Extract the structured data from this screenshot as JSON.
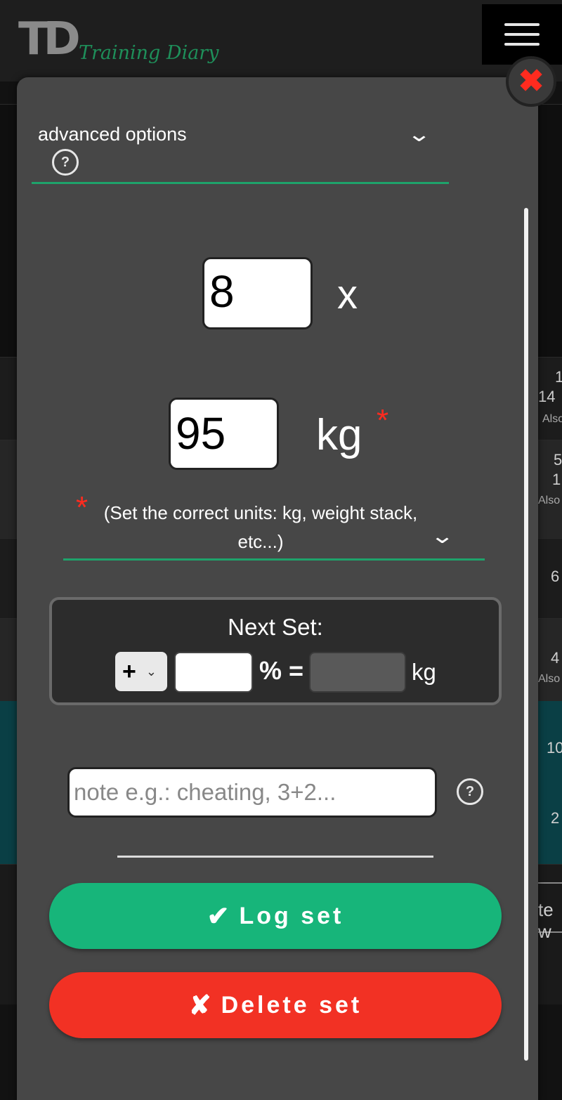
{
  "header": {
    "logo_mark": "TD",
    "logo_text": "Training Diary"
  },
  "background": {
    "values": [
      "1",
      "14",
      "Also",
      "5",
      "1",
      "Also",
      "6",
      "4",
      "Also",
      "10",
      "2"
    ],
    "input_fragment": "te w"
  },
  "modal": {
    "advanced_options_label": "advanced options",
    "help_glyph": "?",
    "reps": {
      "value": "8",
      "multiplier": "x"
    },
    "weight": {
      "value": "95",
      "unit": "kg",
      "required_mark": "*"
    },
    "units_hint": "(Set the correct units: kg, weight stack, etc...)",
    "units_required_mark": "*",
    "next_set": {
      "title": "Next Set:",
      "sign": "+",
      "percent_value": "",
      "equals_label": "% =",
      "result_value": "",
      "unit": "kg"
    },
    "note": {
      "placeholder": "note e.g.: cheating, 3+2...",
      "value": ""
    },
    "log_button": {
      "icon": "✔",
      "label": "Log set"
    },
    "delete_button": {
      "icon": "✘",
      "label": "Delete set"
    },
    "close_glyph": "✖"
  },
  "colors": {
    "accent_green": "#17b57a",
    "underline_green": "#1ea36b",
    "danger_red": "#f23124",
    "modal_bg": "#474747"
  }
}
